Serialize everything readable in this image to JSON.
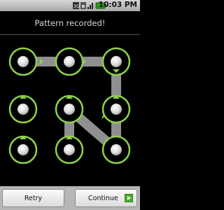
{
  "status_bar": {
    "time": "10:03 PM",
    "network": "3G",
    "icons": [
      "sim-icon",
      "signal-icon",
      "battery-icon"
    ]
  },
  "title": "Pattern recorded!",
  "pattern": {
    "path_order": [
      1,
      2,
      3,
      6,
      9,
      5,
      8
    ],
    "accent_color": "#8ed14a",
    "path_color": "#8f8f8f"
  },
  "buttons": {
    "retry": "Retry",
    "continue": "Continue"
  }
}
